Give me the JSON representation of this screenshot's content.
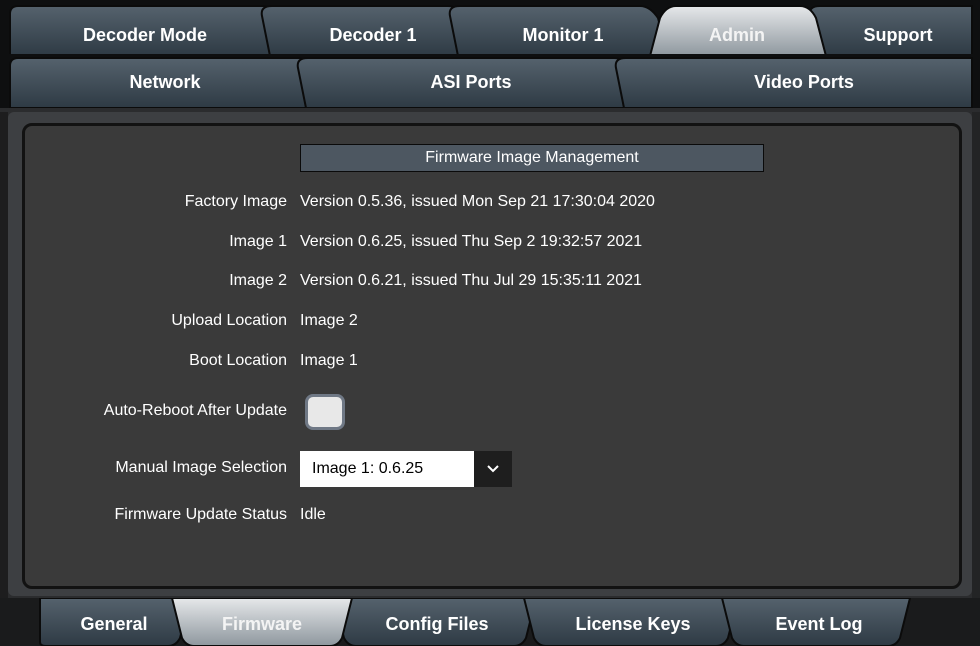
{
  "top_tabs": [
    {
      "label": "Decoder Mode",
      "active": false
    },
    {
      "label": "Decoder 1",
      "active": false
    },
    {
      "label": "Monitor 1",
      "active": false
    },
    {
      "label": "Admin",
      "active": true
    },
    {
      "label": "Support",
      "active": false
    }
  ],
  "sub_tabs": [
    {
      "label": "Network"
    },
    {
      "label": "ASI Ports"
    },
    {
      "label": "Video Ports"
    }
  ],
  "section": {
    "title": "Firmware Image Management",
    "rows": [
      {
        "label": "Factory Image",
        "value": "Version 0.5.36, issued Mon Sep 21 17:30:04 2020"
      },
      {
        "label": "Image 1",
        "value": "Version 0.6.25, issued Thu Sep 2 19:32:57 2021"
      },
      {
        "label": "Image 2",
        "value": "Version 0.6.21, issued Thu Jul 29 15:35:11 2021"
      },
      {
        "label": "Upload Location",
        "value": "Image 2"
      },
      {
        "label": "Boot Location",
        "value": "Image 1"
      }
    ],
    "autoreboot_label": "Auto-Reboot After Update",
    "autoreboot_checked": false,
    "manual_selection_label": "Manual Image Selection",
    "manual_selection_value": "Image 1: 0.6.25",
    "status_label": "Firmware Update Status",
    "status_value": "Idle"
  },
  "bottom_tabs": [
    {
      "label": "General",
      "active": false
    },
    {
      "label": "Firmware",
      "active": true
    },
    {
      "label": "Config Files",
      "active": false
    },
    {
      "label": "License Keys",
      "active": false
    },
    {
      "label": "Event Log",
      "active": false
    }
  ],
  "colors": {
    "tab_dark": "#3a4650",
    "tab_active": "#c4c9cd",
    "panel_bg": "#3a3a3a",
    "header_bg": "#4d5761"
  },
  "icons": {
    "select_arrow": "chevron-down-icon"
  }
}
